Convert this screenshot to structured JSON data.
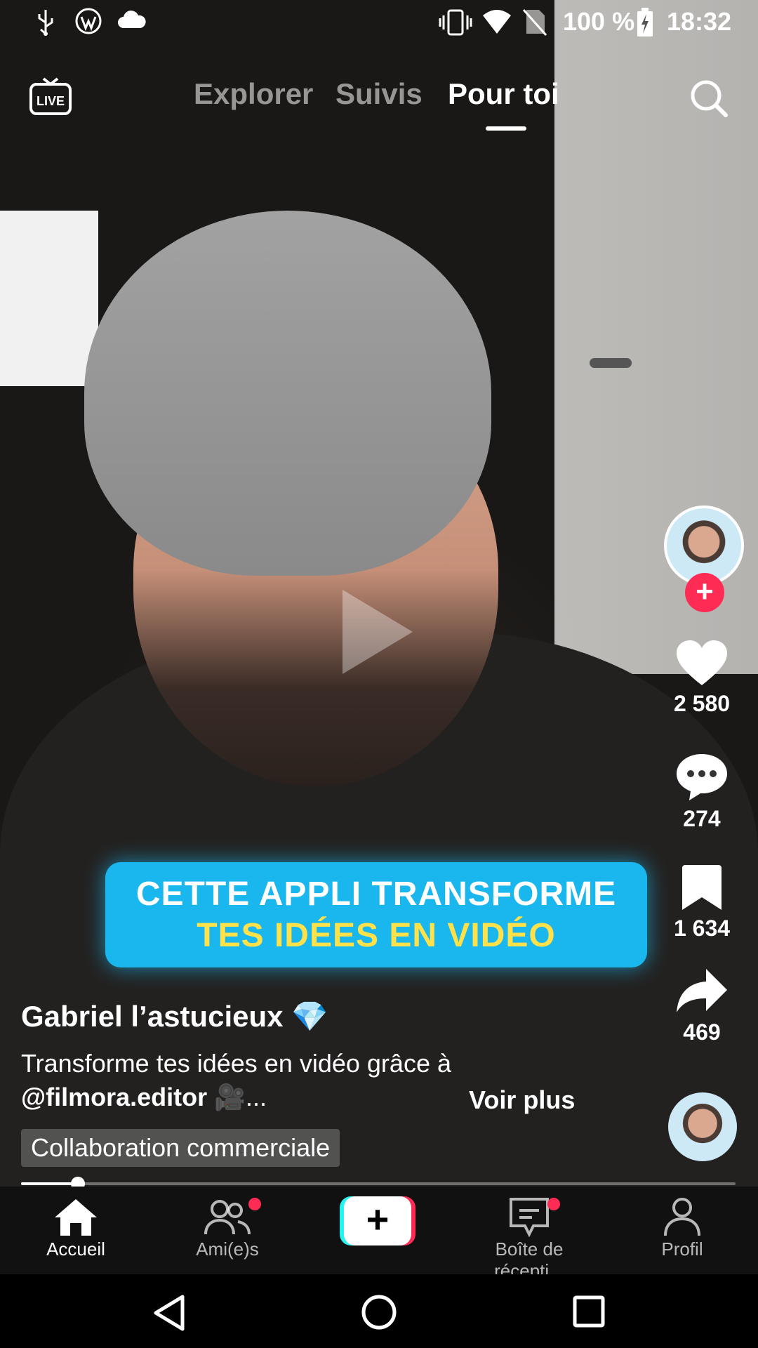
{
  "status_bar": {
    "battery": "100 %",
    "time": "18:32"
  },
  "top_nav": {
    "live_label": "LIVE",
    "tabs": [
      {
        "label": "Explorer"
      },
      {
        "label": "Suivis"
      },
      {
        "label": "Pour toi"
      }
    ],
    "active_tab": "Pour toi"
  },
  "video": {
    "caption_line1": "CETTE APPLI TRANSFORME",
    "caption_line2": "TES IDÉES EN VIDÉO",
    "caption_colors": {
      "banner": "#1ab6ee",
      "line1": "#ffffff",
      "line2": "#ffe14a"
    },
    "progress": 0.08
  },
  "actions": {
    "likes": "2 580",
    "comments": "274",
    "saves": "1 634",
    "shares": "469"
  },
  "post": {
    "username": "Gabriel l’astucieux 💎",
    "description": "Transforme tes idées en vidéo grâce à",
    "mention": "@filmora.editor",
    "desc_suffix": "🎥...",
    "see_more": "Voir plus",
    "collab_label": "Collaboration commerciale"
  },
  "bottom_nav": {
    "items": [
      {
        "label": "Accueil",
        "icon": "home-icon"
      },
      {
        "label": "Ami(e)s",
        "icon": "friends-icon"
      },
      {
        "label": "",
        "icon": "create-icon"
      },
      {
        "label": "Boîte de récepti...",
        "icon": "inbox-icon"
      },
      {
        "label": "Profil",
        "icon": "profile-icon"
      }
    ],
    "accent": "#fe2c55"
  }
}
